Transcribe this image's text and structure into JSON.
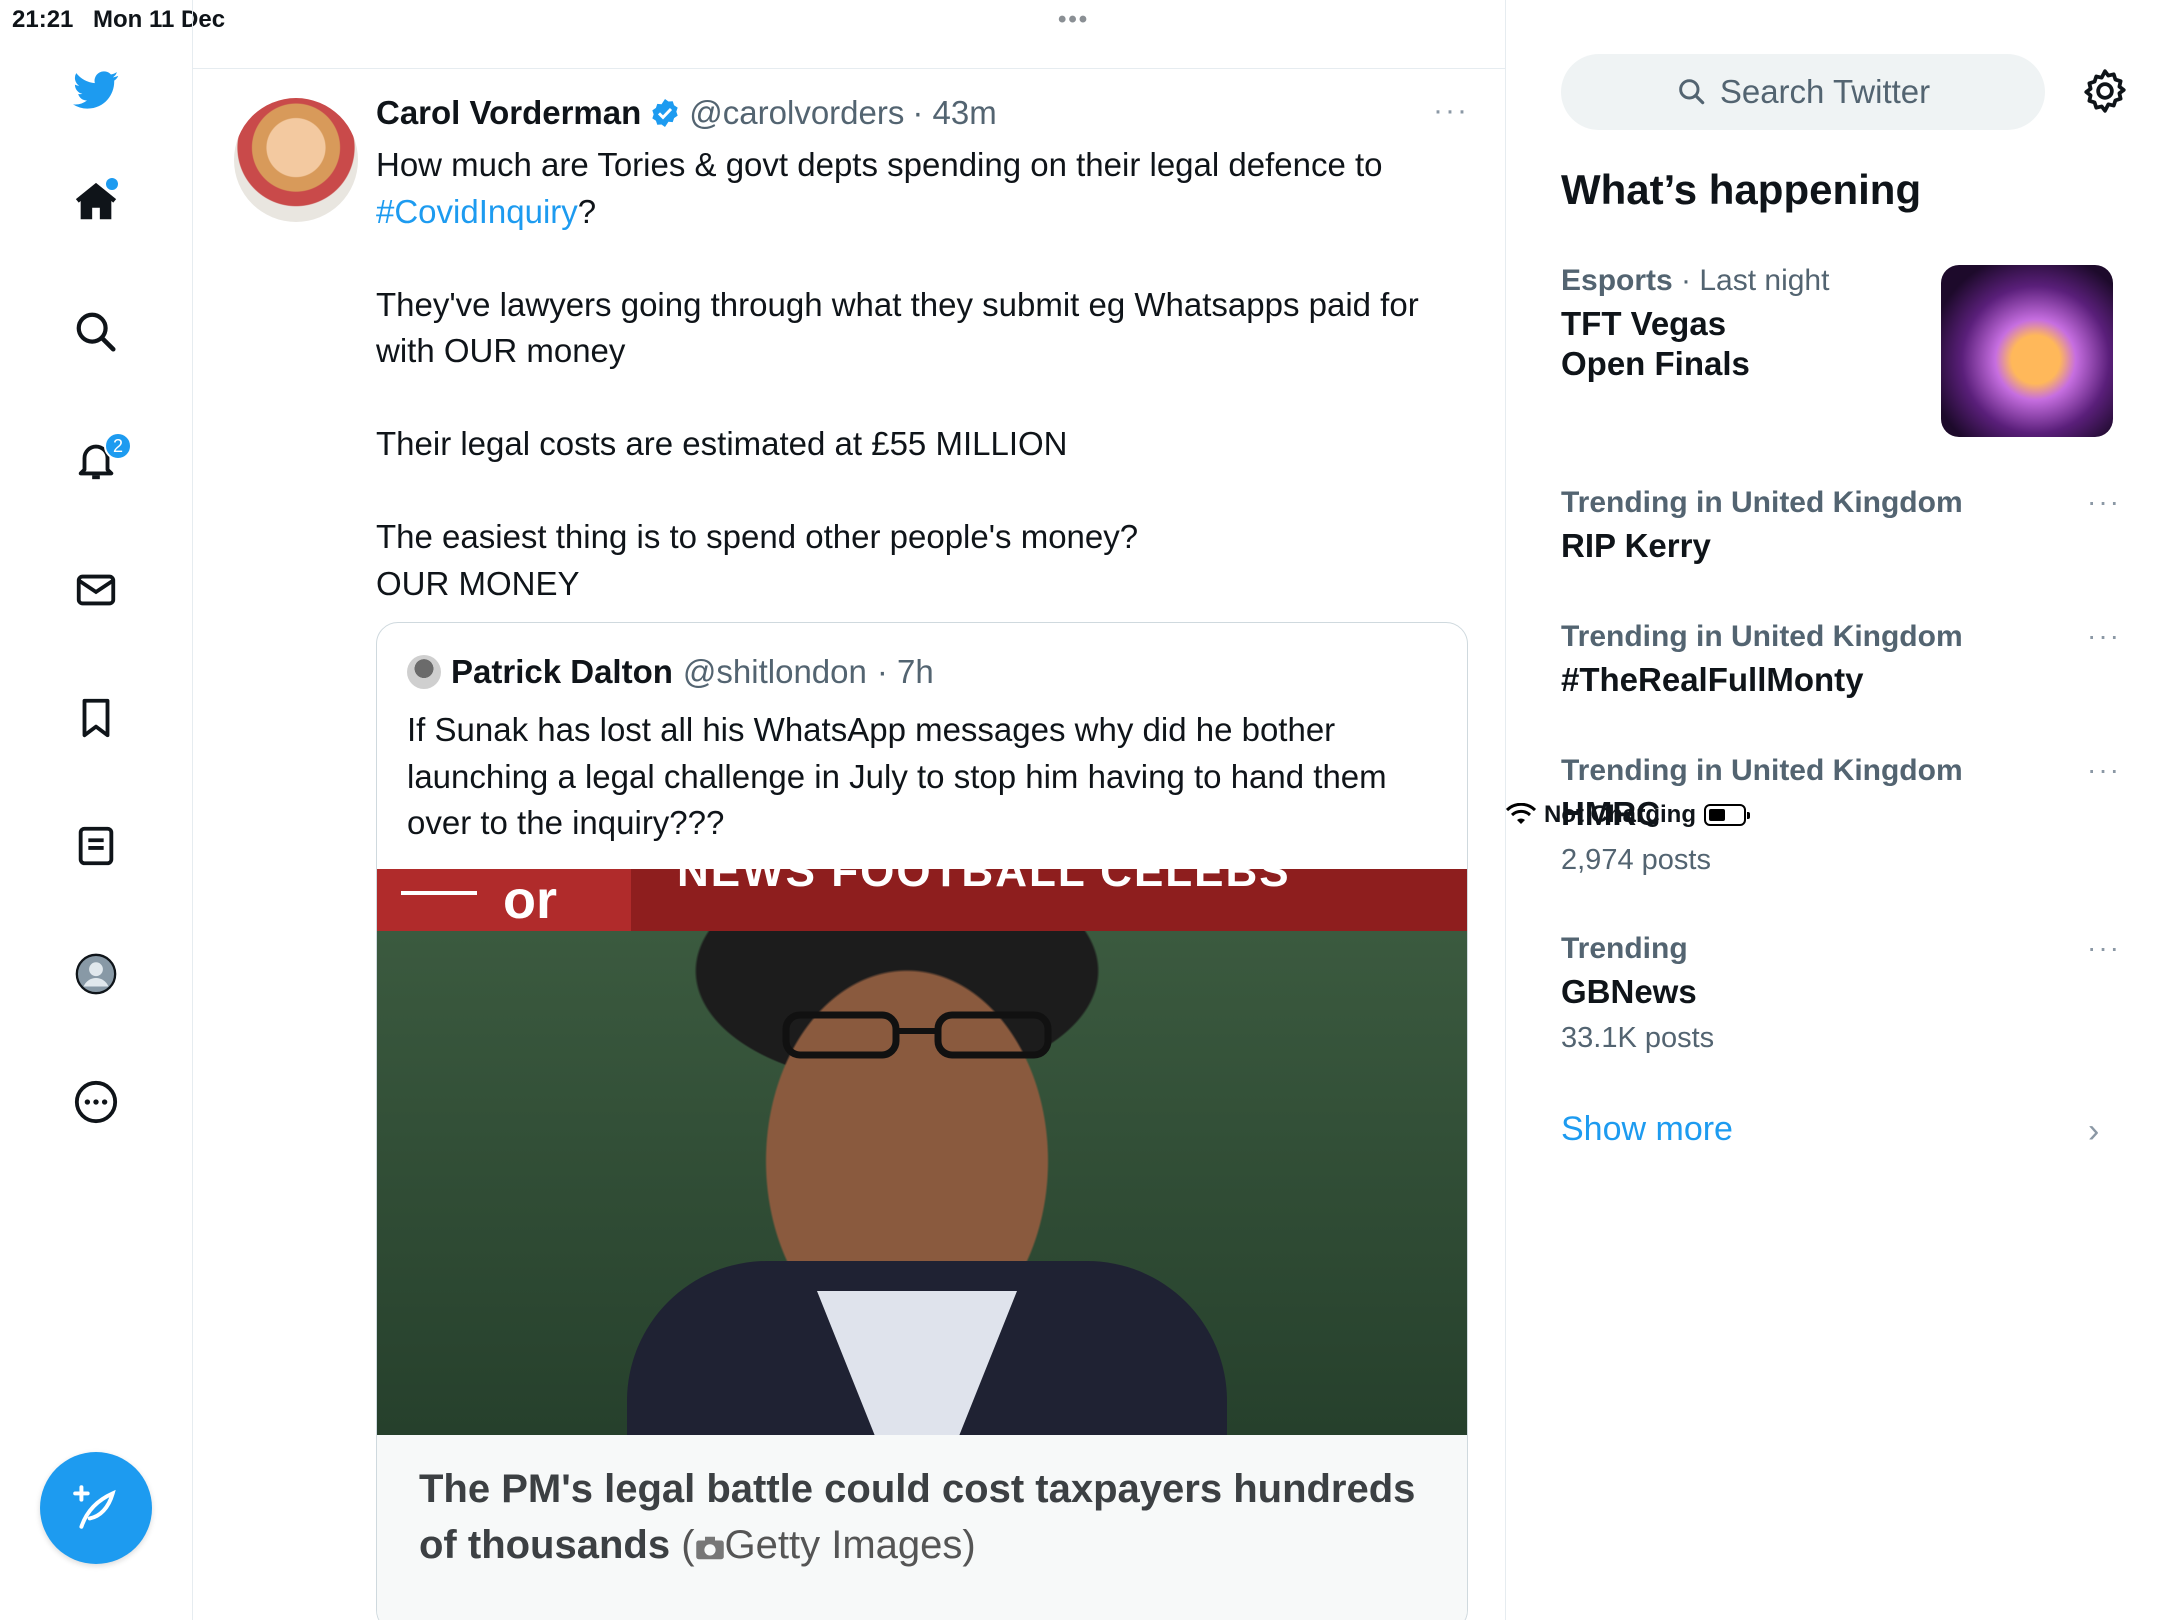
{
  "status_bar": {
    "time": "21:21",
    "date": "Mon 11 Dec",
    "multitask_dots": "•••",
    "charging": "Not Charging",
    "battery_level": 0.45
  },
  "nav": {
    "notification_count": "2",
    "icons": [
      "twitter-logo-icon",
      "home-icon",
      "search-icon",
      "bell-icon",
      "mail-icon",
      "bookmark-icon",
      "lists-icon",
      "profile-icon",
      "more-icon"
    ],
    "accent_color": "#1d9bf0"
  },
  "tweet": {
    "author_name": "Carol Vorderman",
    "handle": "@carolvorders",
    "time": "· 43m",
    "more": "···",
    "lines": {
      "l1": "How much are Tories & govt depts spending on their legal defence to",
      "l2_hashtag": "#CovidInquiry",
      "l2_after": "?",
      "p2a": "They've lawyers going through what they submit eg Whatsapps paid for",
      "p2b": "with OUR money",
      "p3": "Their legal costs are estimated at £55 MILLION",
      "p4a": "The easiest thing is to spend other people's money?",
      "p4b": "OUR MONEY"
    }
  },
  "quote": {
    "author_name": "Patrick Dalton",
    "handle": "@shitlondon",
    "time": "· 7h",
    "text_l1": "If Sunak has lost all his WhatsApp messages why did he bother",
    "text_l2": "launching a legal challenge in July to stop him having to hand them",
    "text_l3": "over to the inquiry???",
    "banner_logo": "or",
    "banner_nav": "NEWS   FOOTBALL   CELEBS",
    "caption_l1": "The PM's legal battle could cost taxpayers hundreds",
    "caption_l2": "of thousands",
    "caption_credit": "Getty Images)",
    "caption_paren": " ("
  },
  "sidebar": {
    "search_placeholder": "Search Twitter",
    "heading": "What’s happening",
    "trends": [
      {
        "category": "Esports",
        "meta_suffix": " · Last night",
        "title_l1": "TFT Vegas",
        "title_l2": "Open Finals"
      },
      {
        "category": "Trending in United Kingdom",
        "title": "RIP Kerry",
        "more": "···"
      },
      {
        "category": "Trending in United Kingdom",
        "title": "#TheRealFullMonty",
        "more": "···"
      },
      {
        "category": "Trending in United Kingdom",
        "title": "HMRC",
        "count": "2,974 posts",
        "more": "···"
      },
      {
        "category": "Trending",
        "title": "GBNews",
        "count": "33.1K posts",
        "more": "···"
      }
    ],
    "show_more": "Show more",
    "chevron": "›"
  }
}
